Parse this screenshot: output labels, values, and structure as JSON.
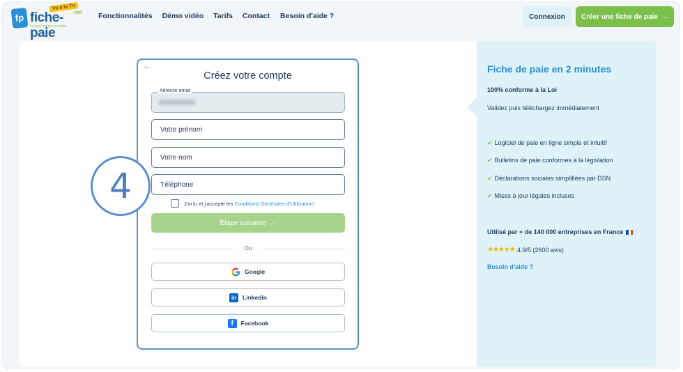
{
  "brand": {
    "logo_mark": "fp",
    "name": "fiche-paie",
    "badge": "Vu à la TV",
    "tld": ".net",
    "tagline": "La paie simple et rodée"
  },
  "nav": {
    "items": [
      "Fonctionnalités",
      "Démo vidéo",
      "Tarifs",
      "Contact",
      "Besoin d'aide ?"
    ]
  },
  "header": {
    "login_label": "Connexion",
    "create_label": "Créer une fiche de paie",
    "create_arrow": "→"
  },
  "form": {
    "back_icon": "←",
    "title": "Créez votre compte",
    "email_label": "Adresse email",
    "prenom_placeholder": "Votre prénom",
    "nom_placeholder": "Votre nom",
    "telephone_placeholder": "Téléphone",
    "terms_prefix": "J'ai lu et j'accepte les",
    "terms_link": "Conditions Générales d'Utilisation*",
    "next_label": "Étape suivante",
    "next_arrow": "→",
    "or_label": "Ou",
    "social": {
      "google": "Google",
      "linkedin": "Linkedin",
      "facebook": "Facebook"
    }
  },
  "step": {
    "number": "4"
  },
  "sidebar": {
    "title": "Fiche de paie en 2 minutes",
    "conformity": "100% conforme à la Loi",
    "validate": "Validez puis téléchargez immédiatement",
    "features": [
      "Logiciel de paie en ligne simple et intuitif",
      "Bulletins de paie conformes à la législation",
      "Déclarations sociales simplifiées par DSN",
      "Mises à jour légales incluses"
    ],
    "used_by": "Utilisé par + de 140 000 entreprises en France",
    "stars": "★★★★★",
    "rating": "4.9/5 (2600 avis)",
    "help": "Besoin d'aide ?"
  },
  "colors": {
    "accent_blue": "#2a8fd6",
    "accent_green": "#7cbf4a",
    "panel_light_blue": "#dff2f8",
    "card_border": "#5b8fc9"
  },
  "icons": {
    "google": "google-icon",
    "linkedin": "linkedin-icon",
    "facebook": "facebook-icon",
    "check": "checkmark-icon",
    "flag": "france-flag-icon"
  }
}
